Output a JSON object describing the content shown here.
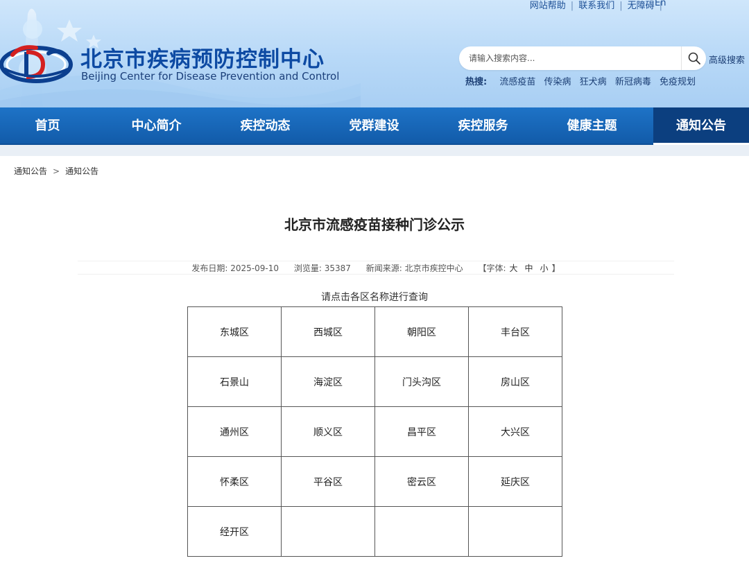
{
  "header": {
    "top_links": [
      "网站帮助",
      "联系我们",
      "无障碍"
    ],
    "lang_link": "En",
    "site_title_cn": "北京市疾病预防控制中心",
    "site_title_en": "Beijing Center for Disease Prevention and Control",
    "search": {
      "placeholder": "请输入搜索内容..."
    },
    "advanced_search": "高级搜索",
    "hot_search_label": "热搜:",
    "hot_search_items": [
      "流感疫苗",
      "传染病",
      "狂犬病",
      "新冠病毒",
      "免疫规划"
    ]
  },
  "nav": {
    "items": [
      "首页",
      "中心简介",
      "疾控动态",
      "党群建设",
      "疾控服务",
      "健康主题",
      "通知公告"
    ],
    "active_index": 6
  },
  "breadcrumb": {
    "items": [
      "通知公告",
      "通知公告"
    ],
    "separator": ">"
  },
  "article": {
    "title": "北京市流感疫苗接种门诊公示",
    "meta": {
      "date_label": "发布日期:",
      "date": "2025-09-10",
      "views_label": "浏览量:",
      "views": "35387",
      "source_label": "新闻来源:",
      "source": "北京市疾控中心",
      "font_label": "【字体:",
      "font_large": "大",
      "font_medium": "中",
      "font_small": "小",
      "font_close": "】"
    },
    "instruction": "请点击各区名称进行查询",
    "districts": [
      [
        "东城区",
        "西城区",
        "朝阳区",
        "丰台区"
      ],
      [
        "石景山",
        "海淀区",
        "门头沟区",
        "房山区"
      ],
      [
        "通州区",
        "顺义区",
        "昌平区",
        "大兴区"
      ],
      [
        "怀柔区",
        "平谷区",
        "密云区",
        "延庆区"
      ],
      [
        "经开区",
        "",
        "",
        ""
      ]
    ]
  },
  "colors": {
    "nav_blue": "#1e73c7",
    "nav_active": "#0c3f7f",
    "title_blue": "#0d4aa3",
    "header_bg": "#b7d8f7"
  }
}
